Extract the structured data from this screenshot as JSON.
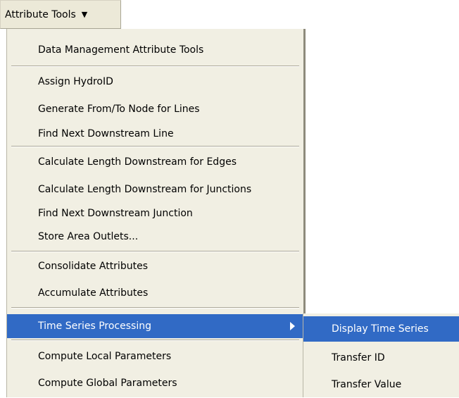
{
  "toolbar": {
    "label": "Attribute Tools",
    "arrow": "▼"
  },
  "menu": {
    "items": [
      {
        "label": "Data Management Attribute Tools"
      },
      {
        "label": "Assign HydroID"
      },
      {
        "label": "Generate From/To Node for Lines"
      },
      {
        "label": "Find Next Downstream Line"
      },
      {
        "label": "Calculate Length Downstream for Edges"
      },
      {
        "label": "Calculate Length Downstream for Junctions"
      },
      {
        "label": "Find Next Downstream Junction"
      },
      {
        "label": "Store Area Outlets..."
      },
      {
        "label": "Consolidate Attributes"
      },
      {
        "label": "Accumulate Attributes"
      },
      {
        "label": "Time Series Processing"
      },
      {
        "label": "Compute Local Parameters"
      },
      {
        "label": "Compute Global Parameters"
      }
    ]
  },
  "submenu": {
    "items": [
      {
        "label": "Display Time Series"
      },
      {
        "label": "Transfer ID"
      },
      {
        "label": "Transfer Value"
      }
    ]
  },
  "colors": {
    "highlight": "#316ac5",
    "menu_bg": "#f1efe3",
    "toolbar_bg": "#ece9d8"
  }
}
